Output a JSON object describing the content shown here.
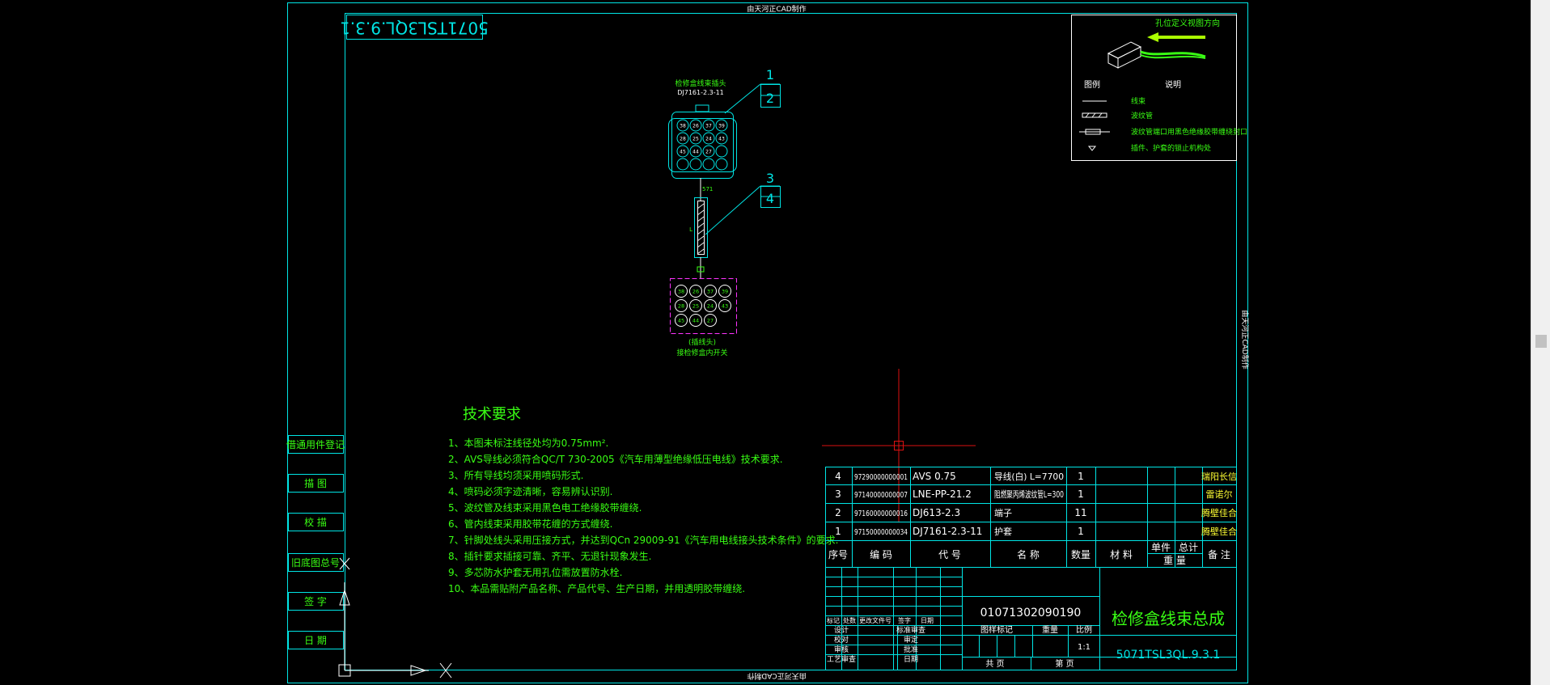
{
  "colors": {
    "background": "#000000",
    "frame": "#00e5e5",
    "text_green": "#39ff14",
    "text_white": "#ffffff",
    "text_yellow": "#ffff33",
    "magenta": "#ff33ff",
    "crosshair": "#dd1111",
    "arrow": "#aaff00"
  },
  "watermark": {
    "top": "由天河正CAD制作",
    "bottom": "由天河正CAD制作",
    "right": "由天河正CAD制作"
  },
  "stamp": "5071TSL3QL.9.3.1",
  "legend": {
    "header": "孔位定义视图方向",
    "col_symbol": "图例",
    "col_desc": "说明",
    "items": [
      {
        "desc": "线束"
      },
      {
        "desc": "波纹管"
      },
      {
        "desc": "波纹管端口用黑色绝缘胶带缠绕封口"
      },
      {
        "desc": "插件、护套的锁止机构处"
      }
    ]
  },
  "connector_top": {
    "title": "检修盒线束插头",
    "part": "DJ7161-2.3-11",
    "pins": [
      "38",
      "26",
      "37",
      "39",
      "28",
      "25",
      "24",
      "43",
      "45",
      "44",
      "27",
      "  ",
      "  ",
      "  ",
      "  "
    ],
    "wire_label_top": "571",
    "wire_label_mid": "L",
    "callouts": [
      "1",
      "2",
      "3",
      "4"
    ]
  },
  "connector_bottom": {
    "pins": [
      "38",
      "26",
      "37",
      "39",
      "28",
      "25",
      "24",
      "43",
      "45",
      "44",
      "27"
    ],
    "caption_1": "(插线头)",
    "caption_2": "接检修盒内开关"
  },
  "tech": {
    "title": "技术要求",
    "lines": [
      "1、本图未标注线径处均为0.75mm².",
      "2、AVS导线必须符合QC/T 730-2005《汽车用薄型绝缘低压电线》技术要求.",
      "3、所有导线均须采用喷码形式.",
      "4、喷码必须字迹清晰，容易辨认识别.",
      "5、波纹管及线束采用黑色电工绝缘胶带缠绕.",
      "6、管内线束采用胶带花缠的方式缠绕.",
      "7、针脚处线头采用压接方式，并达到QCn 29009-91《汽车用电线接头技术条件》的要求.",
      "8、插针要求插接可靠、齐平、无退针现象发生.",
      "9、多芯防水护套无用孔位需放置防水栓.",
      "10、本品需贴附产品名称、产品代号、生产日期，并用透明胶带缠绕."
    ]
  },
  "left_column": [
    "借通用件登记",
    "描 图",
    "校 描",
    "旧底图总号",
    "签 字",
    "日 期"
  ],
  "bom": {
    "rows": [
      {
        "no": "4",
        "code": "97290000000001",
        "part": "AVS 0.75",
        "name": "导线(白) L=7700",
        "qty": "1",
        "note": "瑞阳长信"
      },
      {
        "no": "3",
        "code": "97140000000007",
        "part": "LNE-PP-21.2",
        "name": "阻燃聚丙烯波纹管L=300",
        "qty": "1",
        "note": "雷诺尔"
      },
      {
        "no": "2",
        "code": "97160000000016",
        "part": "DJ613-2.3",
        "name": "端子",
        "qty": "11",
        "note": "腾壁佳合"
      },
      {
        "no": "1",
        "code": "97150000000034",
        "part": "DJ7161-2.3-11",
        "name": "护套",
        "qty": "1",
        "note": "腾壁佳合"
      }
    ],
    "headers": {
      "no": "序号",
      "code": "编 码",
      "part": "代 号",
      "name": "名 称",
      "qty": "数量",
      "material": "材 料",
      "unit": "单件",
      "total": "总计",
      "weight": "重 量",
      "note": "备 注"
    }
  },
  "title_block": {
    "drawing_number": "01071302090190",
    "product_name": "检修盒线束总成",
    "part_code": "5071TSL3QL.9.3.1",
    "change_labels": [
      "标记",
      "处数",
      "更改文件号",
      "签字",
      "日期"
    ],
    "sign_labels": [
      "设计",
      "校对",
      "审核",
      "工艺审查"
    ],
    "sign_labels_2": [
      "标准审查",
      "审定",
      "批准",
      "日期"
    ],
    "stage_label": "图样标记",
    "weight_label": "重量",
    "scale_label": "比例",
    "scale_value": "1:1",
    "sheets_label": "共 页",
    "sheet_label": "第 页"
  }
}
